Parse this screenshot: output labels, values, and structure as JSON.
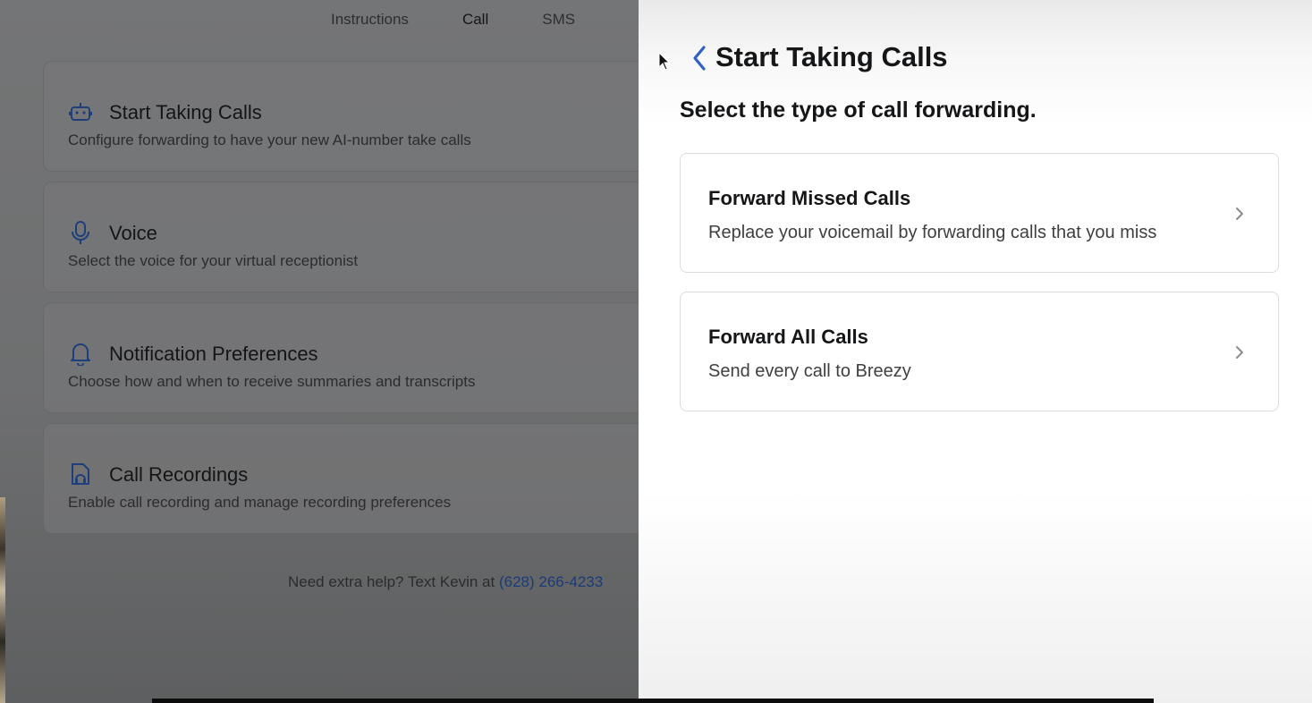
{
  "tabs": [
    {
      "label": "Instructions",
      "active": false
    },
    {
      "label": "Call",
      "active": true
    },
    {
      "label": "SMS",
      "active": false
    }
  ],
  "settings": [
    {
      "title": "Start Taking Calls",
      "description": "Configure forwarding to have your new AI-number take calls",
      "icon": "robot-icon"
    },
    {
      "title": "Voice",
      "description": "Select the voice for your virtual receptionist",
      "icon": "microphone-icon"
    },
    {
      "title": "Notification Preferences",
      "description": "Choose how and when to receive summaries and transcripts",
      "icon": "bell-icon"
    },
    {
      "title": "Call Recordings",
      "description": "Enable call recording and manage recording preferences",
      "icon": "recording-file-icon"
    }
  ],
  "help": {
    "text": "Need extra help? Text Kevin at ",
    "phone": "(628) 266-4233"
  },
  "panel": {
    "title": "Start Taking Calls",
    "subtitle": "Select the type of call forwarding.",
    "options": [
      {
        "title": "Forward Missed Calls",
        "description": "Replace your voicemail by forwarding calls that you miss"
      },
      {
        "title": "Forward All Calls",
        "description": "Send every call to Breezy"
      }
    ]
  },
  "colors": {
    "accent": "#2f62c4",
    "overlay": "#6e6f70",
    "panel_bg": "#ffffff"
  }
}
